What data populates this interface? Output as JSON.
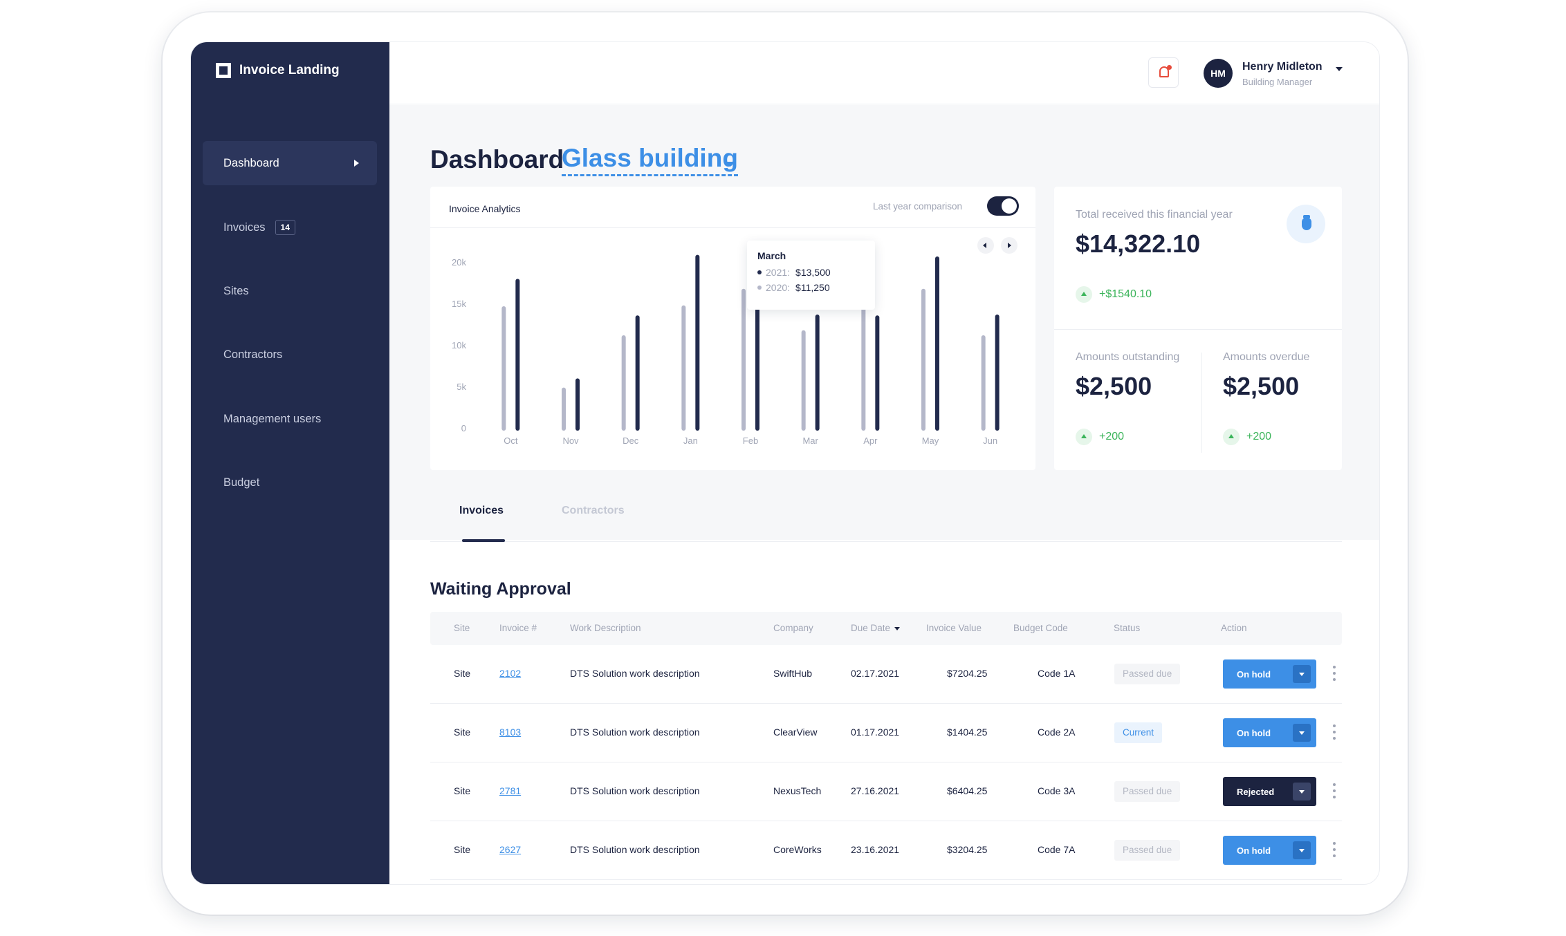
{
  "brand": {
    "name": "Invoice Landing"
  },
  "sidebar": {
    "items": [
      {
        "label": "Dashboard",
        "active": true
      },
      {
        "label": "Invoices",
        "badge": "14"
      },
      {
        "label": "Sites"
      },
      {
        "label": "Contractors"
      },
      {
        "label": "Management users"
      },
      {
        "label": "Budget"
      }
    ]
  },
  "header": {
    "user": {
      "initials": "HM",
      "name": "Henry Midleton",
      "role": "Building Manager"
    },
    "icons": [
      "bell-icon",
      "chevron-down-icon"
    ]
  },
  "page": {
    "title": "Dashboard",
    "building": "Glass building"
  },
  "analytics": {
    "title": "Invoice Analytics",
    "toggle_label": "Last year comparison",
    "toggle_on": true,
    "tooltip": {
      "month": "March",
      "rows": [
        {
          "year": "2021:",
          "value": "$13,500"
        },
        {
          "year": "2020:",
          "value": "$11,250"
        }
      ]
    }
  },
  "chart_data": {
    "type": "bar",
    "categories": [
      "Oct",
      "Nov",
      "Dec",
      "Jan",
      "Feb",
      "Mar",
      "Apr",
      "May",
      "Jun"
    ],
    "y_ticks": [
      "20k",
      "15k",
      "10k",
      "5k",
      "0"
    ],
    "ylim": [
      0,
      20000
    ],
    "grid": false,
    "series": [
      {
        "name": "2020",
        "color": "#b4b7c9",
        "values": [
          14500,
          4700,
          11000,
          14600,
          16600,
          11600,
          18000,
          16600,
          11000
        ]
      },
      {
        "name": "2021",
        "color": "#222b4d",
        "values": [
          17800,
          5800,
          13400,
          20700,
          17100,
          13500,
          13400,
          20500,
          13500
        ]
      }
    ]
  },
  "stats": {
    "total": {
      "label": "Total received this financial year",
      "value": "$14,322.10",
      "delta": "+$1540.10"
    },
    "outstanding": {
      "label": "Amounts outstanding",
      "value": "$2,500",
      "delta": "+200"
    },
    "overdue": {
      "label": "Amounts overdue",
      "value": "$2,500",
      "delta": "+200"
    },
    "accent": "#3bb45a"
  },
  "tabs": [
    {
      "label": "Invoices",
      "active": true
    },
    {
      "label": "Contractors",
      "active": false
    }
  ],
  "table": {
    "title": "Waiting Approval",
    "columns": [
      "Site",
      "Invoice #",
      "Work Description",
      "Company",
      "Due Date",
      "Invoice Value",
      "Budget Code",
      "Status",
      "Action"
    ],
    "rows": [
      {
        "site": "Site",
        "invoice": "2102",
        "description": "DTS Solution work description",
        "company": "SwiftHub",
        "due": "02.17.2021",
        "value": "$7204.25",
        "code": "Code 1A",
        "status": "Passed due",
        "status_type": "passed",
        "action": "On hold",
        "action_type": "hold"
      },
      {
        "site": "Site",
        "invoice": "8103",
        "description": "DTS Solution work description",
        "company": "ClearView",
        "due": "01.17.2021",
        "value": "$1404.25",
        "code": "Code 2A",
        "status": "Current",
        "status_type": "current",
        "action": "On hold",
        "action_type": "hold"
      },
      {
        "site": "Site",
        "invoice": "2781",
        "description": "DTS Solution work description",
        "company": "NexusTech",
        "due": "27.16.2021",
        "value": "$6404.25",
        "code": "Code 3A",
        "status": "Passed due",
        "status_type": "passed",
        "action": "Rejected",
        "action_type": "rejected"
      },
      {
        "site": "Site",
        "invoice": "2627",
        "description": "DTS Solution work description",
        "company": "CoreWorks",
        "due": "23.16.2021",
        "value": "$3204.25",
        "code": "Code 7A",
        "status": "Passed due",
        "status_type": "passed",
        "action": "On hold",
        "action_type": "hold"
      }
    ]
  }
}
